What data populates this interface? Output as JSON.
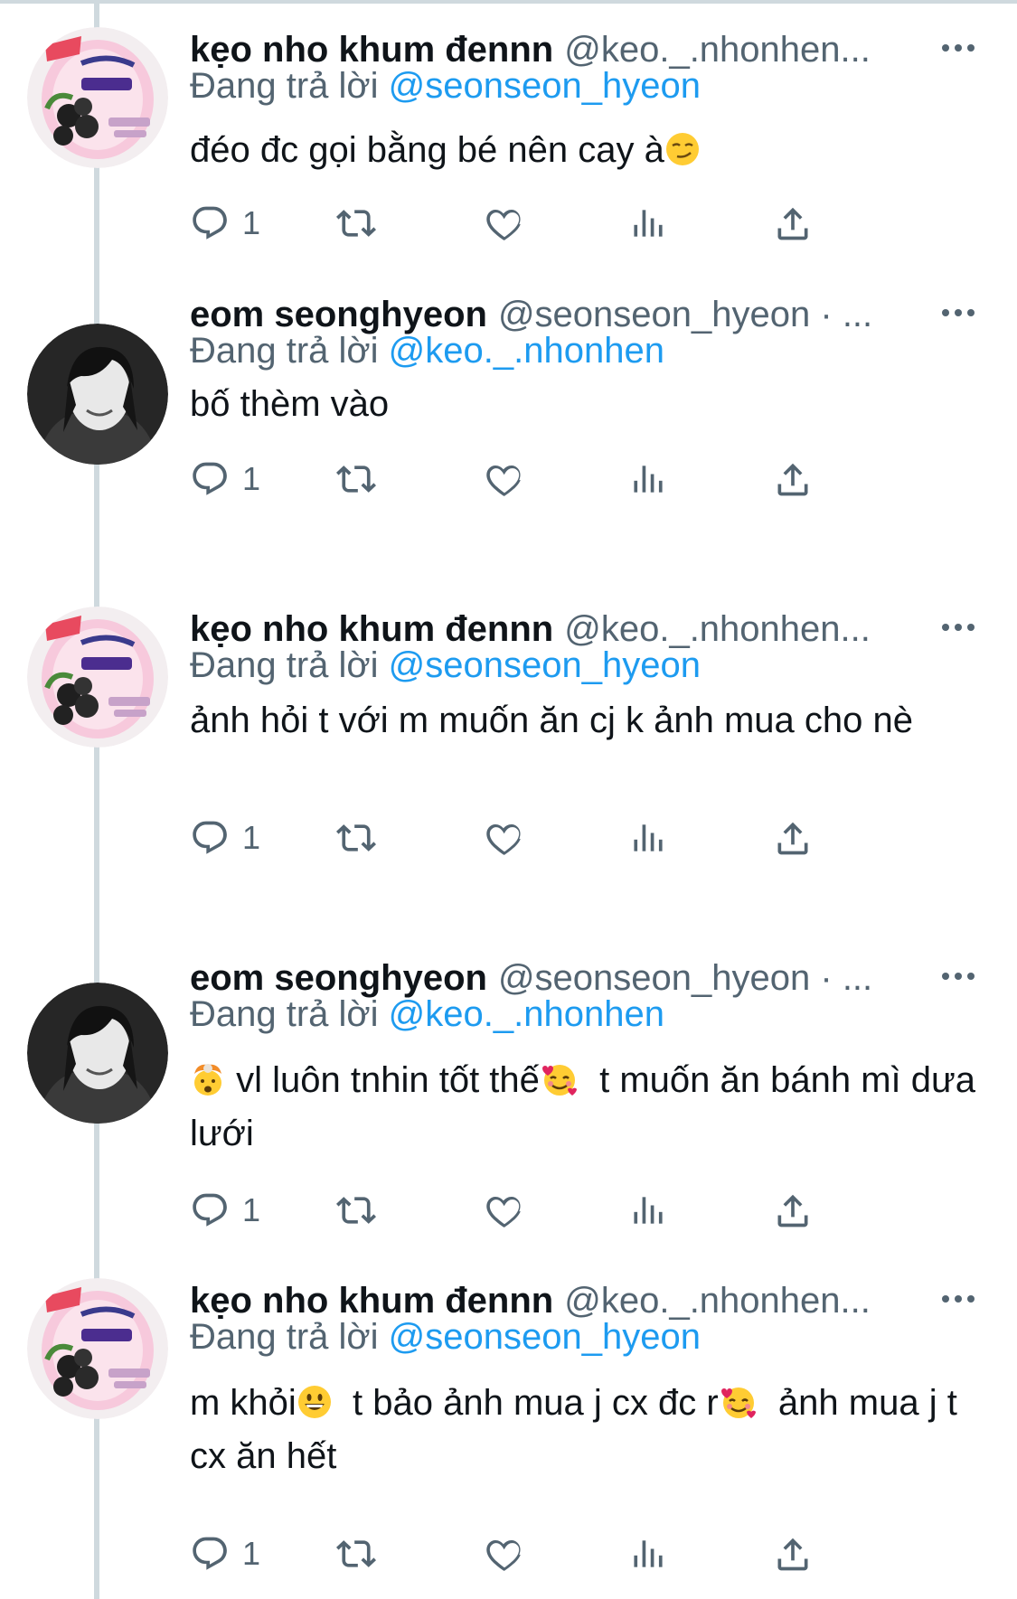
{
  "colors": {
    "text": "#0f1419",
    "secondary": "#536471",
    "link": "#1d9bf0",
    "thread_line": "#cfd9de"
  },
  "tweets": [
    {
      "avatar": "candy-pack-avatar",
      "name": "kẹo nho khum đennn",
      "handle": "@keo._.nhonhen...",
      "reply_prefix": "Đang trả lời",
      "reply_to": "@seonseon_hyeon",
      "text_parts": [
        "đéo đc gọi bằng bé nên cay à",
        "",
        "",
        ""
      ],
      "emojis": [
        "smirk"
      ],
      "replies": "1"
    },
    {
      "avatar": "portrait-avatar",
      "name": "eom seonghyeon",
      "handle": "@seonseon_hyeon · ...",
      "reply_prefix": "Đang trả lời",
      "reply_to": "@keo._.nhonhen",
      "text_parts": [
        "bố thèm vào",
        "",
        "",
        ""
      ],
      "emojis": [],
      "replies": "1"
    },
    {
      "avatar": "candy-pack-avatar",
      "name": "kẹo nho khum đennn",
      "handle": "@keo._.nhonhen...",
      "reply_prefix": "Đang trả lời",
      "reply_to": "@seonseon_hyeon",
      "text_parts": [
        "ảnh hỏi t với m muốn ăn cj k ảnh mua cho nè",
        "",
        "",
        ""
      ],
      "emojis": [],
      "replies": "1"
    },
    {
      "avatar": "portrait-avatar",
      "name": "eom seonghyeon",
      "handle": "@seonseon_hyeon · ...",
      "reply_prefix": "Đang trả lời",
      "reply_to": "@keo._.nhonhen",
      "text_parts": [
        "",
        " vl luôn tnhin tốt thế",
        "  t muốn ăn bánh mì dưa lưới",
        ""
      ],
      "emojis": [
        "exploding-head",
        "smiling-hearts"
      ],
      "replies": "1"
    },
    {
      "avatar": "candy-pack-avatar",
      "name": "kẹo nho khum đennn",
      "handle": "@keo._.nhonhen...",
      "reply_prefix": "Đang trả lời",
      "reply_to": "@seonseon_hyeon",
      "text_parts": [
        "m khỏi",
        "  t bảo ảnh mua j cx đc r",
        "  ảnh mua j t cx ăn hết",
        ""
      ],
      "emojis": [
        "grinning",
        "smiling-hearts"
      ],
      "replies": "1"
    }
  ]
}
